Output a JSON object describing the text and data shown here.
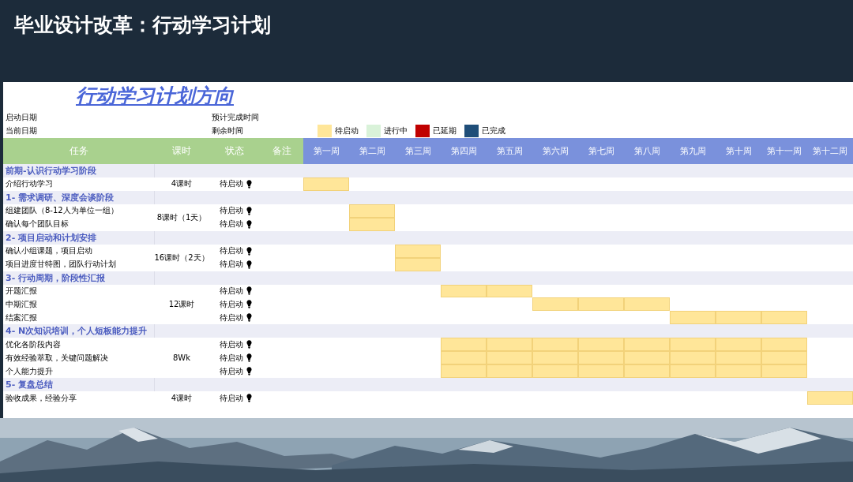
{
  "slide_title": "毕业设计改革：行动学习计划",
  "sheet": {
    "title": "行动学习计划方向",
    "info": [
      {
        "label": "启动日期"
      },
      {
        "label": "预计完成时间"
      },
      {
        "label": "当前日期"
      },
      {
        "label": "剩余时间"
      }
    ],
    "legend": [
      {
        "label": "待启动",
        "color": "#ffe699"
      },
      {
        "label": "进行中",
        "color": "#d9f2d9"
      },
      {
        "label": "已延期",
        "color": "#c00000"
      },
      {
        "label": "已完成",
        "color": "#1f4e79"
      }
    ],
    "columns": [
      "任务",
      "课时",
      "状态",
      "备注"
    ],
    "weeks": [
      "第一周",
      "第二周",
      "第三周",
      "第四周",
      "第五周",
      "第六周",
      "第七周",
      "第八周",
      "第九周",
      "第十周",
      "第十一周",
      "第十二周"
    ],
    "sections": [
      {
        "title": "前期-认识行动学习阶段",
        "hours": "4课时",
        "tasks": [
          {
            "name": "介绍行动学习",
            "status": "待启动",
            "weeks": [
              true,
              false,
              false,
              false,
              false,
              false,
              false,
              false,
              false,
              false,
              false,
              false
            ]
          }
        ]
      },
      {
        "title": "1- 需求调研、深度会谈阶段",
        "hours": "8课时（1天）",
        "tasks": [
          {
            "name": "组建团队（8-12人为单位一组）",
            "status": "待启动",
            "weeks": [
              false,
              true,
              false,
              false,
              false,
              false,
              false,
              false,
              false,
              false,
              false,
              false
            ]
          },
          {
            "name": "确认每个团队目标",
            "status": "待启动",
            "weeks": [
              false,
              true,
              false,
              false,
              false,
              false,
              false,
              false,
              false,
              false,
              false,
              false
            ]
          }
        ]
      },
      {
        "title": "2- 项目启动和计划安排",
        "hours": "16课时（2天）",
        "tasks": [
          {
            "name": "确认小组课题，项目启动",
            "status": "待启动",
            "weeks": [
              false,
              false,
              true,
              false,
              false,
              false,
              false,
              false,
              false,
              false,
              false,
              false
            ]
          },
          {
            "name": "项目进度甘特图，团队行动计划",
            "status": "待启动",
            "weeks": [
              false,
              false,
              true,
              false,
              false,
              false,
              false,
              false,
              false,
              false,
              false,
              false
            ]
          }
        ]
      },
      {
        "title": "3- 行动周期，阶段性汇报",
        "hours": "12课时",
        "tasks": [
          {
            "name": "开题汇报",
            "status": "待启动",
            "weeks": [
              false,
              false,
              false,
              true,
              true,
              false,
              false,
              false,
              false,
              false,
              false,
              false
            ]
          },
          {
            "name": "中期汇报",
            "status": "待启动",
            "weeks": [
              false,
              false,
              false,
              false,
              false,
              true,
              true,
              true,
              false,
              false,
              false,
              false
            ]
          },
          {
            "name": "结案汇报",
            "status": "待启动",
            "weeks": [
              false,
              false,
              false,
              false,
              false,
              false,
              false,
              false,
              true,
              true,
              true,
              false
            ]
          }
        ]
      },
      {
        "title": "4- N次知识培训，个人短板能力提升",
        "hours": "8Wk",
        "tasks": [
          {
            "name": "优化各阶段内容",
            "status": "待启动",
            "weeks": [
              false,
              false,
              false,
              true,
              true,
              true,
              true,
              true,
              true,
              true,
              true,
              false
            ]
          },
          {
            "name": "有效经验萃取，关键问题解决",
            "status": "待启动",
            "weeks": [
              false,
              false,
              false,
              true,
              true,
              true,
              true,
              true,
              true,
              true,
              true,
              false
            ]
          },
          {
            "name": "个人能力提升",
            "status": "待启动",
            "weeks": [
              false,
              false,
              false,
              true,
              true,
              true,
              true,
              true,
              true,
              true,
              true,
              false
            ]
          }
        ]
      },
      {
        "title": "5- 复盘总结",
        "hours": "4课时",
        "tasks": [
          {
            "name": "验收成果，经验分享",
            "status": "待启动",
            "weeks": [
              false,
              false,
              false,
              false,
              false,
              false,
              false,
              false,
              false,
              false,
              false,
              true
            ]
          }
        ]
      }
    ]
  }
}
